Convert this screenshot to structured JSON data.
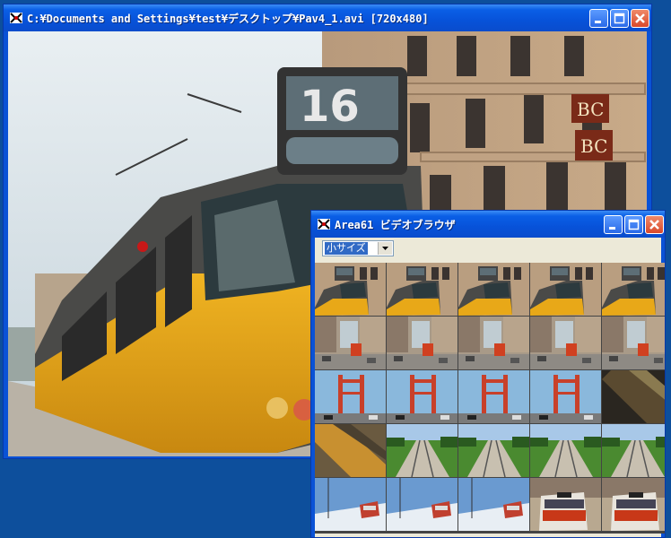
{
  "main_window": {
    "title": "C:¥Documents and Settings¥test¥デスクトップ¥Pav4_1.avi [720x480]",
    "tram_number": "16",
    "sign_text": "BC"
  },
  "browser_window": {
    "title": "Area61 ビデオブラウザ",
    "size_select": {
      "value": "小サイズ"
    },
    "thumbnails": [
      {
        "scene": "tram"
      },
      {
        "scene": "tram"
      },
      {
        "scene": "tram"
      },
      {
        "scene": "tram"
      },
      {
        "scene": "tram"
      },
      {
        "scene": "street"
      },
      {
        "scene": "street"
      },
      {
        "scene": "street"
      },
      {
        "scene": "street"
      },
      {
        "scene": "street"
      },
      {
        "scene": "bridge"
      },
      {
        "scene": "bridge"
      },
      {
        "scene": "bridge"
      },
      {
        "scene": "bridge"
      },
      {
        "scene": "dark-blur"
      },
      {
        "scene": "blur"
      },
      {
        "scene": "railway"
      },
      {
        "scene": "railway"
      },
      {
        "scene": "railway"
      },
      {
        "scene": "railway"
      },
      {
        "scene": "snow"
      },
      {
        "scene": "snow"
      },
      {
        "scene": "snow"
      },
      {
        "scene": "red-tram"
      },
      {
        "scene": "red-tram"
      }
    ]
  },
  "colors": {
    "desktop": "#0d4f9c",
    "titlebar": "#0752d9",
    "tram_yellow": "#e8a818",
    "close_button": "#d9482a"
  }
}
